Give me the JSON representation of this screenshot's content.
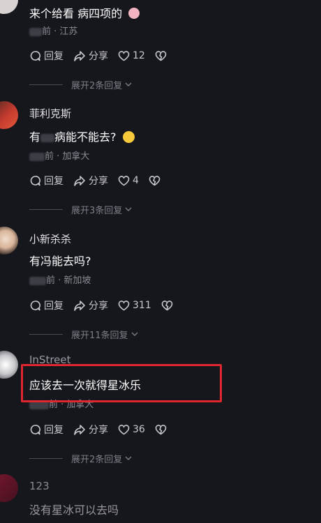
{
  "comments": [
    {
      "name": "",
      "text": "来个给看 病四项的",
      "location": "前 · 江苏",
      "reply_label": "回复",
      "share_label": "分享",
      "likes": "12",
      "expand_label": "展开2条回复"
    },
    {
      "name": "菲利克斯",
      "text": "有 病能不能去?",
      "location": "前 · 加拿大",
      "reply_label": "回复",
      "share_label": "分享",
      "likes": "4",
      "expand_label": "展开3条回复"
    },
    {
      "name": "小新杀杀",
      "text": "有冯能去吗?",
      "location": "前 · 新加坡",
      "reply_label": "回复",
      "share_label": "分享",
      "likes": "311",
      "expand_label": "展开11条回复"
    },
    {
      "name": "InStreet",
      "text": "应该去一次就得星冰乐",
      "location": "前 · 加拿大",
      "reply_label": "回复",
      "share_label": "分享",
      "likes": "36",
      "expand_label": "展开2条回复"
    },
    {
      "name": "123",
      "text": "没有星冰可以去吗"
    }
  ],
  "colors": {
    "background": "#16171d",
    "highlight_border": "#e0262e"
  }
}
